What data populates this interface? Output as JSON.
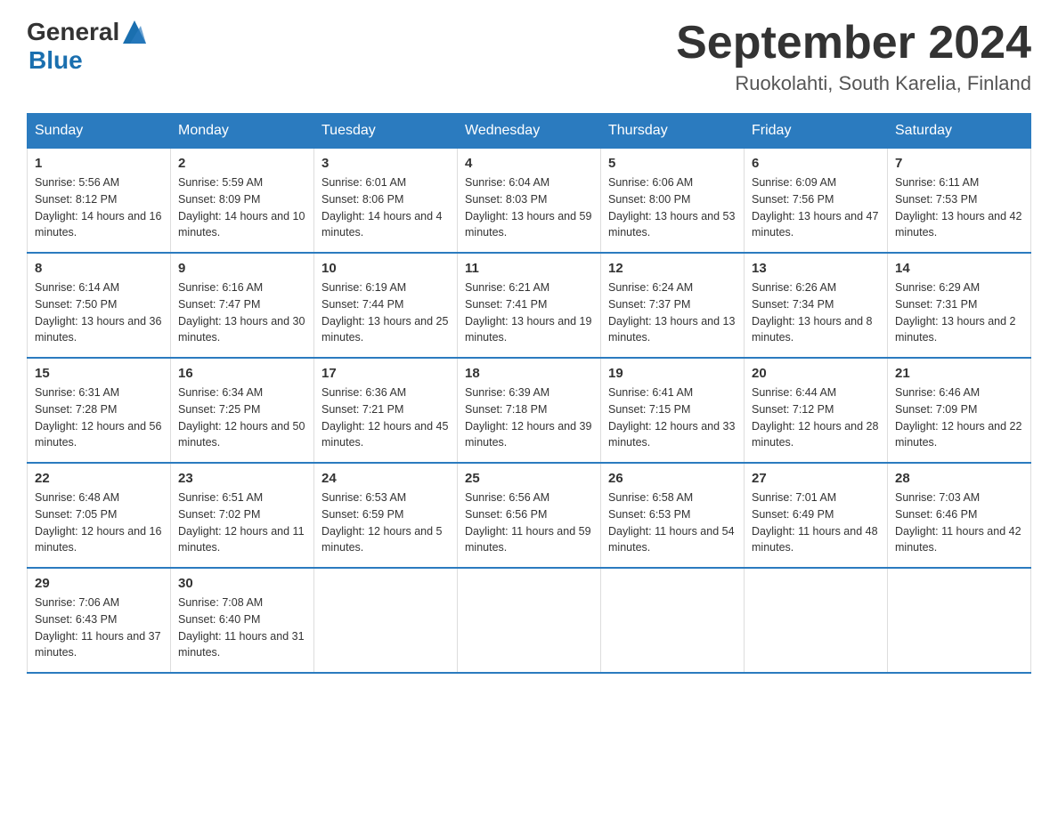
{
  "header": {
    "logo_general": "General",
    "logo_blue": "Blue",
    "title": "September 2024",
    "subtitle": "Ruokolahti, South Karelia, Finland"
  },
  "days_of_week": [
    "Sunday",
    "Monday",
    "Tuesday",
    "Wednesday",
    "Thursday",
    "Friday",
    "Saturday"
  ],
  "weeks": [
    [
      {
        "day": "1",
        "sunrise": "5:56 AM",
        "sunset": "8:12 PM",
        "daylight": "14 hours and 16 minutes."
      },
      {
        "day": "2",
        "sunrise": "5:59 AM",
        "sunset": "8:09 PM",
        "daylight": "14 hours and 10 minutes."
      },
      {
        "day": "3",
        "sunrise": "6:01 AM",
        "sunset": "8:06 PM",
        "daylight": "14 hours and 4 minutes."
      },
      {
        "day": "4",
        "sunrise": "6:04 AM",
        "sunset": "8:03 PM",
        "daylight": "13 hours and 59 minutes."
      },
      {
        "day": "5",
        "sunrise": "6:06 AM",
        "sunset": "8:00 PM",
        "daylight": "13 hours and 53 minutes."
      },
      {
        "day": "6",
        "sunrise": "6:09 AM",
        "sunset": "7:56 PM",
        "daylight": "13 hours and 47 minutes."
      },
      {
        "day": "7",
        "sunrise": "6:11 AM",
        "sunset": "7:53 PM",
        "daylight": "13 hours and 42 minutes."
      }
    ],
    [
      {
        "day": "8",
        "sunrise": "6:14 AM",
        "sunset": "7:50 PM",
        "daylight": "13 hours and 36 minutes."
      },
      {
        "day": "9",
        "sunrise": "6:16 AM",
        "sunset": "7:47 PM",
        "daylight": "13 hours and 30 minutes."
      },
      {
        "day": "10",
        "sunrise": "6:19 AM",
        "sunset": "7:44 PM",
        "daylight": "13 hours and 25 minutes."
      },
      {
        "day": "11",
        "sunrise": "6:21 AM",
        "sunset": "7:41 PM",
        "daylight": "13 hours and 19 minutes."
      },
      {
        "day": "12",
        "sunrise": "6:24 AM",
        "sunset": "7:37 PM",
        "daylight": "13 hours and 13 minutes."
      },
      {
        "day": "13",
        "sunrise": "6:26 AM",
        "sunset": "7:34 PM",
        "daylight": "13 hours and 8 minutes."
      },
      {
        "day": "14",
        "sunrise": "6:29 AM",
        "sunset": "7:31 PM",
        "daylight": "13 hours and 2 minutes."
      }
    ],
    [
      {
        "day": "15",
        "sunrise": "6:31 AM",
        "sunset": "7:28 PM",
        "daylight": "12 hours and 56 minutes."
      },
      {
        "day": "16",
        "sunrise": "6:34 AM",
        "sunset": "7:25 PM",
        "daylight": "12 hours and 50 minutes."
      },
      {
        "day": "17",
        "sunrise": "6:36 AM",
        "sunset": "7:21 PM",
        "daylight": "12 hours and 45 minutes."
      },
      {
        "day": "18",
        "sunrise": "6:39 AM",
        "sunset": "7:18 PM",
        "daylight": "12 hours and 39 minutes."
      },
      {
        "day": "19",
        "sunrise": "6:41 AM",
        "sunset": "7:15 PM",
        "daylight": "12 hours and 33 minutes."
      },
      {
        "day": "20",
        "sunrise": "6:44 AM",
        "sunset": "7:12 PM",
        "daylight": "12 hours and 28 minutes."
      },
      {
        "day": "21",
        "sunrise": "6:46 AM",
        "sunset": "7:09 PM",
        "daylight": "12 hours and 22 minutes."
      }
    ],
    [
      {
        "day": "22",
        "sunrise": "6:48 AM",
        "sunset": "7:05 PM",
        "daylight": "12 hours and 16 minutes."
      },
      {
        "day": "23",
        "sunrise": "6:51 AM",
        "sunset": "7:02 PM",
        "daylight": "12 hours and 11 minutes."
      },
      {
        "day": "24",
        "sunrise": "6:53 AM",
        "sunset": "6:59 PM",
        "daylight": "12 hours and 5 minutes."
      },
      {
        "day": "25",
        "sunrise": "6:56 AM",
        "sunset": "6:56 PM",
        "daylight": "11 hours and 59 minutes."
      },
      {
        "day": "26",
        "sunrise": "6:58 AM",
        "sunset": "6:53 PM",
        "daylight": "11 hours and 54 minutes."
      },
      {
        "day": "27",
        "sunrise": "7:01 AM",
        "sunset": "6:49 PM",
        "daylight": "11 hours and 48 minutes."
      },
      {
        "day": "28",
        "sunrise": "7:03 AM",
        "sunset": "6:46 PM",
        "daylight": "11 hours and 42 minutes."
      }
    ],
    [
      {
        "day": "29",
        "sunrise": "7:06 AM",
        "sunset": "6:43 PM",
        "daylight": "11 hours and 37 minutes."
      },
      {
        "day": "30",
        "sunrise": "7:08 AM",
        "sunset": "6:40 PM",
        "daylight": "11 hours and 31 minutes."
      },
      null,
      null,
      null,
      null,
      null
    ]
  ],
  "labels": {
    "sunrise": "Sunrise:",
    "sunset": "Sunset:",
    "daylight": "Daylight:"
  }
}
